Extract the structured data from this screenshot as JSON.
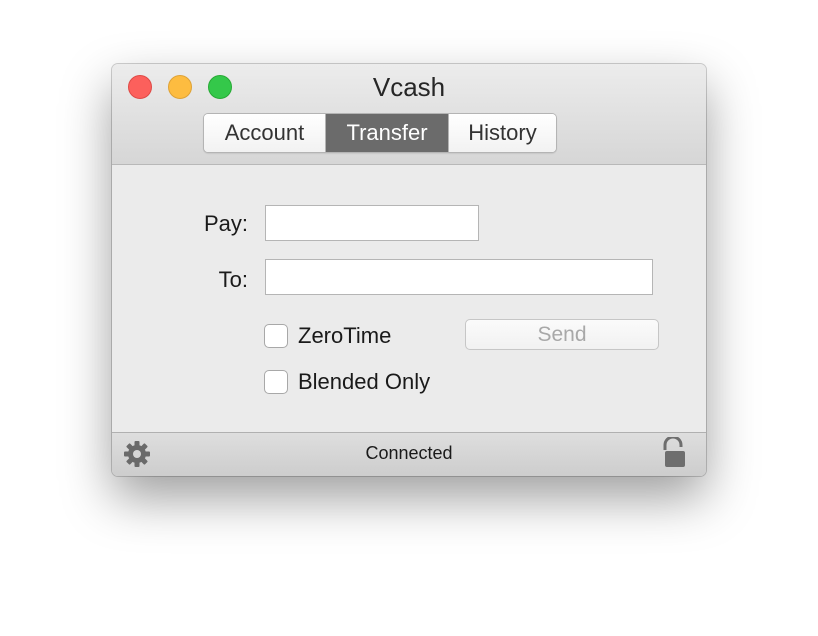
{
  "window": {
    "title": "Vcash"
  },
  "tabs": [
    {
      "label": "Account",
      "active": false
    },
    {
      "label": "Transfer",
      "active": true
    },
    {
      "label": "History",
      "active": false
    }
  ],
  "form": {
    "pay_label": "Pay:",
    "pay_value": "",
    "to_label": "To:",
    "to_value": "",
    "zerotime_label": "ZeroTime",
    "zerotime_checked": false,
    "blended_label": "Blended Only",
    "blended_checked": false,
    "send_label": "Send",
    "send_enabled": false
  },
  "status": {
    "text": "Connected",
    "settings_icon": "gear-icon",
    "lock_icon": "unlocked-padlock-icon"
  },
  "colors": {
    "close": "#fc605c",
    "minimize": "#fdbc40",
    "zoom": "#34c84a",
    "active_tab": "#6b6b6b"
  }
}
